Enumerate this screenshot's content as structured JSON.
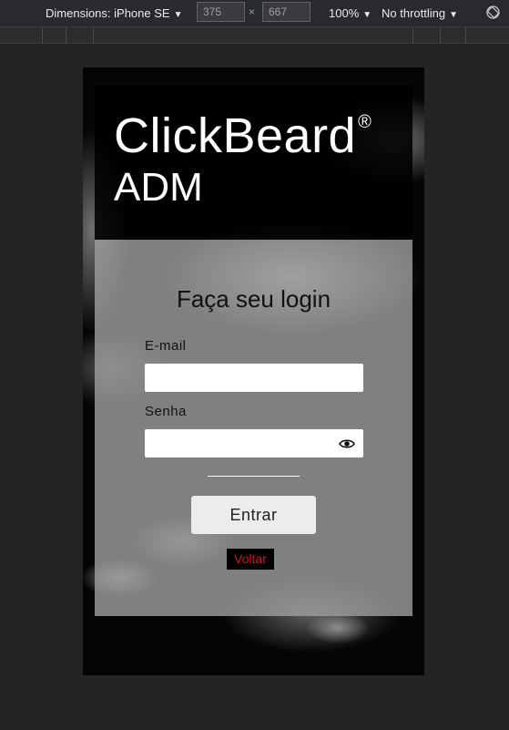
{
  "devtools": {
    "dimensions_label": "Dimensions: iPhone SE",
    "width_value": "375",
    "height_value": "667",
    "times_symbol": "×",
    "zoom_label": "100%",
    "throttling_label": "No throttling",
    "caret": "▼",
    "rotate_icon": "rotate-icon"
  },
  "app": {
    "brand_name": "ClickBeard",
    "brand_mark": "®",
    "brand_subtitle": "ADM"
  },
  "login": {
    "title": "Faça seu login",
    "email_label": "E-mail",
    "email_value": "",
    "password_label": "Senha",
    "password_value": "",
    "show_password_icon": "eye-icon",
    "submit_label": "Entrar",
    "back_label": "Voltar"
  },
  "colors": {
    "back_link_text": "#d01818",
    "form_panel": "#9c9c9c",
    "header_panel": "#000000"
  }
}
